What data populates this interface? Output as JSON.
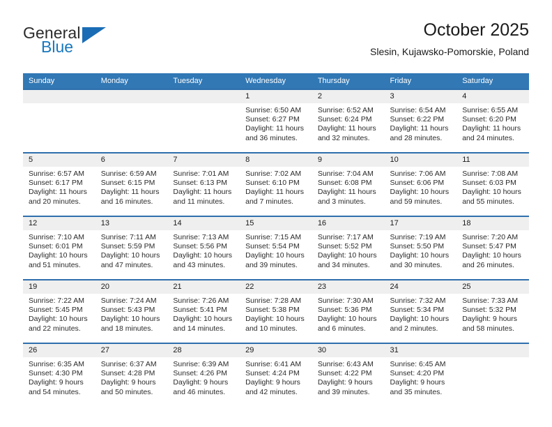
{
  "logo": {
    "word_top": "General",
    "word_bottom": "Blue",
    "accent_color": "#1a6db5"
  },
  "header": {
    "title": "October 2025",
    "subtitle": "Slesin, Kujawsko-Pomorskie, Poland"
  },
  "theme": {
    "header_blue": "#3178b5",
    "rule_blue": "#2f6fad",
    "daynum_band": "#efefef"
  },
  "labels": {
    "sunrise_prefix": "Sunrise:",
    "sunset_prefix": "Sunset:",
    "daylight_prefix": "Daylight:"
  },
  "weekday_headers": [
    "Sunday",
    "Monday",
    "Tuesday",
    "Wednesday",
    "Thursday",
    "Friday",
    "Saturday"
  ],
  "weeks": [
    [
      {
        "day": "",
        "sunrise": "",
        "sunset": "",
        "daylight_line1": "",
        "daylight_line2": ""
      },
      {
        "day": "",
        "sunrise": "",
        "sunset": "",
        "daylight_line1": "",
        "daylight_line2": ""
      },
      {
        "day": "",
        "sunrise": "",
        "sunset": "",
        "daylight_line1": "",
        "daylight_line2": ""
      },
      {
        "day": "1",
        "sunrise": "Sunrise: 6:50 AM",
        "sunset": "Sunset: 6:27 PM",
        "daylight_line1": "Daylight: 11 hours",
        "daylight_line2": "and 36 minutes."
      },
      {
        "day": "2",
        "sunrise": "Sunrise: 6:52 AM",
        "sunset": "Sunset: 6:24 PM",
        "daylight_line1": "Daylight: 11 hours",
        "daylight_line2": "and 32 minutes."
      },
      {
        "day": "3",
        "sunrise": "Sunrise: 6:54 AM",
        "sunset": "Sunset: 6:22 PM",
        "daylight_line1": "Daylight: 11 hours",
        "daylight_line2": "and 28 minutes."
      },
      {
        "day": "4",
        "sunrise": "Sunrise: 6:55 AM",
        "sunset": "Sunset: 6:20 PM",
        "daylight_line1": "Daylight: 11 hours",
        "daylight_line2": "and 24 minutes."
      }
    ],
    [
      {
        "day": "5",
        "sunrise": "Sunrise: 6:57 AM",
        "sunset": "Sunset: 6:17 PM",
        "daylight_line1": "Daylight: 11 hours",
        "daylight_line2": "and 20 minutes."
      },
      {
        "day": "6",
        "sunrise": "Sunrise: 6:59 AM",
        "sunset": "Sunset: 6:15 PM",
        "daylight_line1": "Daylight: 11 hours",
        "daylight_line2": "and 16 minutes."
      },
      {
        "day": "7",
        "sunrise": "Sunrise: 7:01 AM",
        "sunset": "Sunset: 6:13 PM",
        "daylight_line1": "Daylight: 11 hours",
        "daylight_line2": "and 11 minutes."
      },
      {
        "day": "8",
        "sunrise": "Sunrise: 7:02 AM",
        "sunset": "Sunset: 6:10 PM",
        "daylight_line1": "Daylight: 11 hours",
        "daylight_line2": "and 7 minutes."
      },
      {
        "day": "9",
        "sunrise": "Sunrise: 7:04 AM",
        "sunset": "Sunset: 6:08 PM",
        "daylight_line1": "Daylight: 11 hours",
        "daylight_line2": "and 3 minutes."
      },
      {
        "day": "10",
        "sunrise": "Sunrise: 7:06 AM",
        "sunset": "Sunset: 6:06 PM",
        "daylight_line1": "Daylight: 10 hours",
        "daylight_line2": "and 59 minutes."
      },
      {
        "day": "11",
        "sunrise": "Sunrise: 7:08 AM",
        "sunset": "Sunset: 6:03 PM",
        "daylight_line1": "Daylight: 10 hours",
        "daylight_line2": "and 55 minutes."
      }
    ],
    [
      {
        "day": "12",
        "sunrise": "Sunrise: 7:10 AM",
        "sunset": "Sunset: 6:01 PM",
        "daylight_line1": "Daylight: 10 hours",
        "daylight_line2": "and 51 minutes."
      },
      {
        "day": "13",
        "sunrise": "Sunrise: 7:11 AM",
        "sunset": "Sunset: 5:59 PM",
        "daylight_line1": "Daylight: 10 hours",
        "daylight_line2": "and 47 minutes."
      },
      {
        "day": "14",
        "sunrise": "Sunrise: 7:13 AM",
        "sunset": "Sunset: 5:56 PM",
        "daylight_line1": "Daylight: 10 hours",
        "daylight_line2": "and 43 minutes."
      },
      {
        "day": "15",
        "sunrise": "Sunrise: 7:15 AM",
        "sunset": "Sunset: 5:54 PM",
        "daylight_line1": "Daylight: 10 hours",
        "daylight_line2": "and 39 minutes."
      },
      {
        "day": "16",
        "sunrise": "Sunrise: 7:17 AM",
        "sunset": "Sunset: 5:52 PM",
        "daylight_line1": "Daylight: 10 hours",
        "daylight_line2": "and 34 minutes."
      },
      {
        "day": "17",
        "sunrise": "Sunrise: 7:19 AM",
        "sunset": "Sunset: 5:50 PM",
        "daylight_line1": "Daylight: 10 hours",
        "daylight_line2": "and 30 minutes."
      },
      {
        "day": "18",
        "sunrise": "Sunrise: 7:20 AM",
        "sunset": "Sunset: 5:47 PM",
        "daylight_line1": "Daylight: 10 hours",
        "daylight_line2": "and 26 minutes."
      }
    ],
    [
      {
        "day": "19",
        "sunrise": "Sunrise: 7:22 AM",
        "sunset": "Sunset: 5:45 PM",
        "daylight_line1": "Daylight: 10 hours",
        "daylight_line2": "and 22 minutes."
      },
      {
        "day": "20",
        "sunrise": "Sunrise: 7:24 AM",
        "sunset": "Sunset: 5:43 PM",
        "daylight_line1": "Daylight: 10 hours",
        "daylight_line2": "and 18 minutes."
      },
      {
        "day": "21",
        "sunrise": "Sunrise: 7:26 AM",
        "sunset": "Sunset: 5:41 PM",
        "daylight_line1": "Daylight: 10 hours",
        "daylight_line2": "and 14 minutes."
      },
      {
        "day": "22",
        "sunrise": "Sunrise: 7:28 AM",
        "sunset": "Sunset: 5:38 PM",
        "daylight_line1": "Daylight: 10 hours",
        "daylight_line2": "and 10 minutes."
      },
      {
        "day": "23",
        "sunrise": "Sunrise: 7:30 AM",
        "sunset": "Sunset: 5:36 PM",
        "daylight_line1": "Daylight: 10 hours",
        "daylight_line2": "and 6 minutes."
      },
      {
        "day": "24",
        "sunrise": "Sunrise: 7:32 AM",
        "sunset": "Sunset: 5:34 PM",
        "daylight_line1": "Daylight: 10 hours",
        "daylight_line2": "and 2 minutes."
      },
      {
        "day": "25",
        "sunrise": "Sunrise: 7:33 AM",
        "sunset": "Sunset: 5:32 PM",
        "daylight_line1": "Daylight: 9 hours",
        "daylight_line2": "and 58 minutes."
      }
    ],
    [
      {
        "day": "26",
        "sunrise": "Sunrise: 6:35 AM",
        "sunset": "Sunset: 4:30 PM",
        "daylight_line1": "Daylight: 9 hours",
        "daylight_line2": "and 54 minutes."
      },
      {
        "day": "27",
        "sunrise": "Sunrise: 6:37 AM",
        "sunset": "Sunset: 4:28 PM",
        "daylight_line1": "Daylight: 9 hours",
        "daylight_line2": "and 50 minutes."
      },
      {
        "day": "28",
        "sunrise": "Sunrise: 6:39 AM",
        "sunset": "Sunset: 4:26 PM",
        "daylight_line1": "Daylight: 9 hours",
        "daylight_line2": "and 46 minutes."
      },
      {
        "day": "29",
        "sunrise": "Sunrise: 6:41 AM",
        "sunset": "Sunset: 4:24 PM",
        "daylight_line1": "Daylight: 9 hours",
        "daylight_line2": "and 42 minutes."
      },
      {
        "day": "30",
        "sunrise": "Sunrise: 6:43 AM",
        "sunset": "Sunset: 4:22 PM",
        "daylight_line1": "Daylight: 9 hours",
        "daylight_line2": "and 39 minutes."
      },
      {
        "day": "31",
        "sunrise": "Sunrise: 6:45 AM",
        "sunset": "Sunset: 4:20 PM",
        "daylight_line1": "Daylight: 9 hours",
        "daylight_line2": "and 35 minutes."
      },
      {
        "day": "",
        "sunrise": "",
        "sunset": "",
        "daylight_line1": "",
        "daylight_line2": ""
      }
    ]
  ]
}
